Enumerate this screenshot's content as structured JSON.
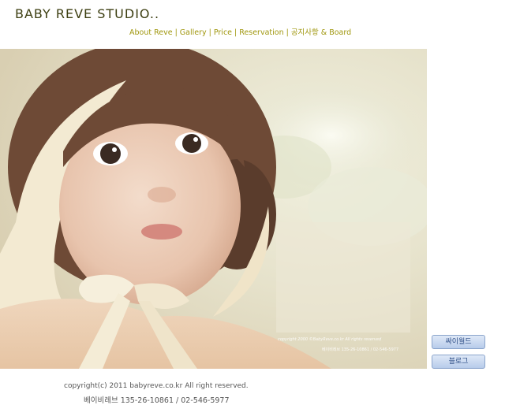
{
  "logo": {
    "text": "BABY REVE STUDIO.."
  },
  "nav": {
    "items": [
      {
        "label": "About Reve"
      },
      {
        "label": "Gallery"
      },
      {
        "label": "Price"
      },
      {
        "label": "Reservation"
      },
      {
        "label": "공지사항 & Board"
      }
    ],
    "separator": "|"
  },
  "photo": {
    "watermark_line1": "copyright 2000 ©BabyReve.co.kr All rights reserved",
    "watermark_line2": "베이비레브 135-26-10861 / 02-546-5977"
  },
  "side_buttons": {
    "cyworld": "싸이월드",
    "blog": "블로그"
  },
  "footer": {
    "copyright": "copyright(c) 2011 babyreve.co.kr All right reserved.",
    "business": "베이비레브 135-26-10861 / 02-546-5977"
  },
  "colors": {
    "logo": "#3d3f12",
    "nav": "#a0970e",
    "button_text": "#2d4d86"
  }
}
